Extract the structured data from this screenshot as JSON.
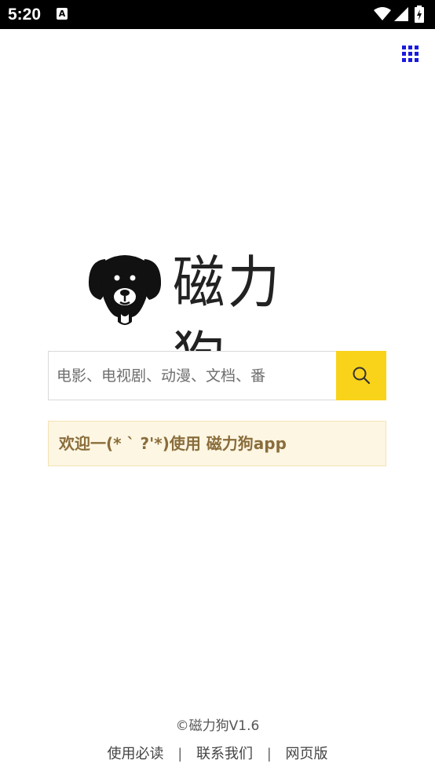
{
  "status_bar": {
    "time": "5:20",
    "notification_glyph": "A",
    "icons": [
      "wifi-icon",
      "signal-icon",
      "battery-icon"
    ]
  },
  "header": {
    "menu_icon": "grid-menu-icon",
    "accent_color": "#1a1ae0"
  },
  "logo": {
    "title": "磁力狗",
    "icon": "dog-head-icon"
  },
  "search": {
    "placeholder": "电影、电视剧、动漫、文档、番",
    "value": "",
    "button_icon": "search-icon",
    "button_color": "#f9d31a"
  },
  "welcome": {
    "message": "欢迎一(* ` ?'*)使用 磁力狗app"
  },
  "footer": {
    "copyright": "©磁力狗V1.6",
    "links": [
      "使用必读",
      "联系我们",
      "网页版"
    ],
    "separator": "|"
  }
}
